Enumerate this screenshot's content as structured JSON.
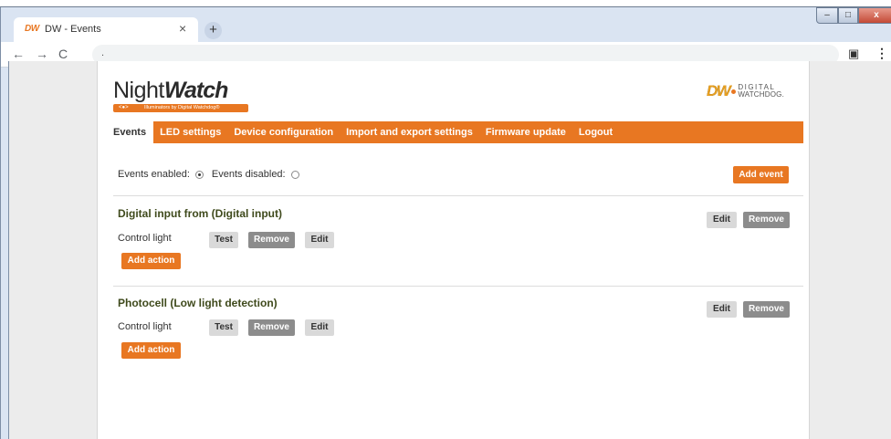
{
  "browser": {
    "tab_title": "DW - Events",
    "tab_favicon": "DW",
    "tab_close": "×",
    "new_tab": "+",
    "url": ".",
    "window_controls": {
      "minimize": "–",
      "maximize": "□",
      "close": "x"
    },
    "icons": {
      "back": "←",
      "forward": "→",
      "reload": "C",
      "extension": "▣",
      "menu": "⋮"
    }
  },
  "header": {
    "logo_word_light": "Night",
    "logo_word_bold": "Watch",
    "logo_tagline": "Illuminators by Digital Watchdog®",
    "brand_mark": "DW",
    "brand_line1": "DIGITAL",
    "brand_line2": "WATCHDOG."
  },
  "nav": {
    "items": [
      {
        "label": "Events",
        "active": true
      },
      {
        "label": "LED settings",
        "active": false
      },
      {
        "label": "Device configuration",
        "active": false
      },
      {
        "label": "Import and export settings",
        "active": false
      },
      {
        "label": "Firmware update",
        "active": false
      },
      {
        "label": "Logout",
        "active": false
      }
    ]
  },
  "events_state": {
    "enabled_label": "Events enabled:",
    "disabled_label": "Events disabled:",
    "selected": "enabled",
    "add_event_label": "Add event"
  },
  "events": [
    {
      "title": "Digital input from (Digital input)",
      "edit_label": "Edit",
      "remove_label": "Remove",
      "action_label": "Control light",
      "test_label": "Test",
      "action_remove_label": "Remove",
      "action_edit_label": "Edit",
      "add_action_label": "Add action"
    },
    {
      "title": "Photocell (Low light detection)",
      "edit_label": "Edit",
      "remove_label": "Remove",
      "action_label": "Control light",
      "test_label": "Test",
      "action_remove_label": "Remove",
      "action_edit_label": "Edit",
      "add_action_label": "Add action"
    }
  ],
  "colors": {
    "accent": "#e87722",
    "event_title": "#3f4a1c",
    "button_dark": "#8c8c8c",
    "button_light": "#d9d9d9"
  }
}
